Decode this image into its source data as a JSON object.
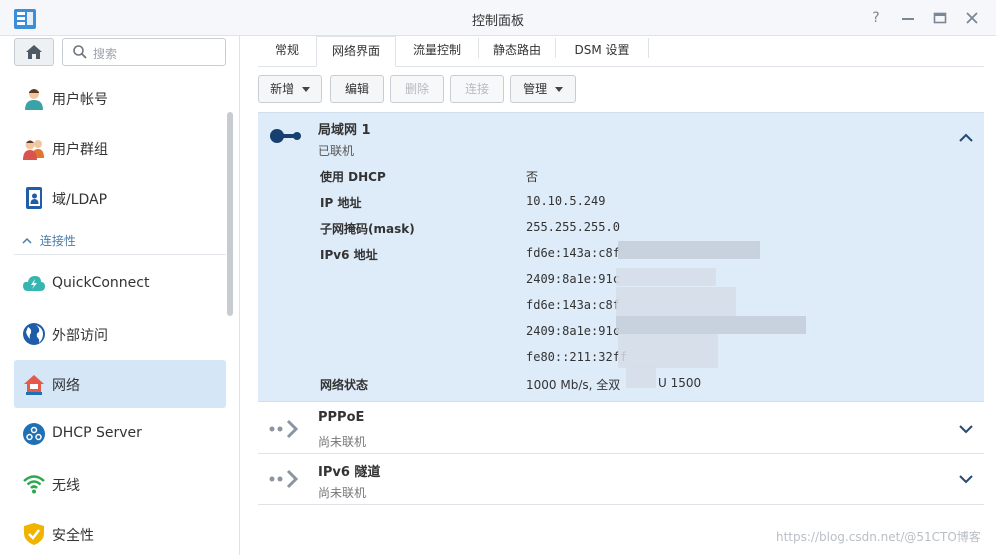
{
  "window": {
    "title": "控制面板",
    "help_icon": "question-icon",
    "minimize_icon": "minimize-icon",
    "maximize_icon": "maximize-icon",
    "close_icon": "close-icon"
  },
  "sidebar": {
    "search_placeholder": "搜索",
    "section_connectivity": "连接性",
    "items": [
      {
        "label": "用户帐号",
        "icon": "user-icon"
      },
      {
        "label": "用户群组",
        "icon": "user-group-icon"
      },
      {
        "label": "域/LDAP",
        "icon": "directory-icon"
      },
      {
        "label": "QuickConnect",
        "icon": "cloud-icon"
      },
      {
        "label": "外部访问",
        "icon": "globe-icon"
      },
      {
        "label": "网络",
        "icon": "network-house-icon",
        "active": true
      },
      {
        "label": "DHCP Server",
        "icon": "dhcp-icon"
      },
      {
        "label": "无线",
        "icon": "wifi-icon"
      },
      {
        "label": "安全性",
        "icon": "shield-icon"
      }
    ]
  },
  "tabs": [
    {
      "label": "常规",
      "active": false
    },
    {
      "label": "网络界面",
      "active": true
    },
    {
      "label": "流量控制",
      "active": false
    },
    {
      "label": "静态路由",
      "active": false
    },
    {
      "label": "DSM 设置",
      "active": false
    }
  ],
  "toolbar": {
    "new_label": "新增",
    "edit_label": "编辑",
    "delete_label": "删除",
    "connect_label": "连接",
    "manage_label": "管理"
  },
  "interfaces": [
    {
      "name": "局域网 1",
      "status": "已联机",
      "expanded": true,
      "details": {
        "dhcp_label": "使用 DHCP",
        "dhcp_value": "否",
        "ip_label": "IP 地址",
        "ip_value": "10.10.5.249",
        "mask_label": "子网掩码(mask)",
        "mask_value": "255.255.255.0",
        "ipv6_label": "IPv6 地址",
        "ipv6_values": [
          "fd6e:143a:c8f",
          "2409:8a1e:91c",
          "fd6e:143a:c8f",
          "2409:8a1e:91c",
          "fe80::211:32ff"
        ],
        "netstatus_label": "网络状态",
        "netstatus_value": "1000 Mb/s, 全双",
        "netstatus_value_tail": "U 1500"
      }
    },
    {
      "name": "PPPoE",
      "status": "尚未联机",
      "expanded": false
    },
    {
      "name": "IPv6 隧道",
      "status": "尚未联机",
      "expanded": false
    }
  ],
  "watermark": "https://blog.csdn.net/@51CTO博客",
  "colors": {
    "accent": "#2f6bb3",
    "active_panel": "#deebf8",
    "active_nav": "#d5e6f7"
  }
}
